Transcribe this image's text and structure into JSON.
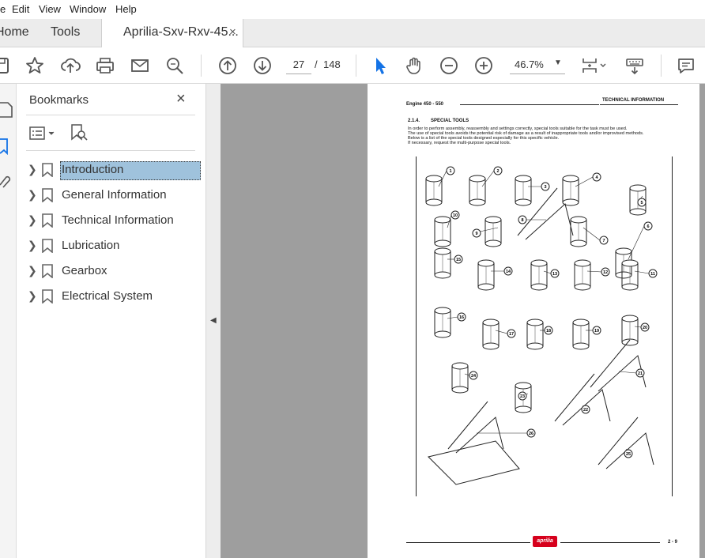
{
  "menu": [
    "e",
    "Edit",
    "View",
    "Window",
    "Help"
  ],
  "tabs": {
    "home": "Home",
    "tools": "Tools",
    "document": "Aprilia-Sxv-Rxv-45...",
    "close": "×"
  },
  "toolbar": {
    "page_current": "27",
    "page_separator": "/",
    "page_total": "148",
    "zoom": "46.7%"
  },
  "bookmarks": {
    "title": "Bookmarks",
    "close": "×",
    "items": [
      {
        "label": "Introduction",
        "selected": true
      },
      {
        "label": "General Information",
        "selected": false
      },
      {
        "label": "Technical Information",
        "selected": false
      },
      {
        "label": "Lubrication",
        "selected": false
      },
      {
        "label": "Gearbox",
        "selected": false
      },
      {
        "label": "Electrical System",
        "selected": false
      }
    ]
  },
  "page": {
    "header_left": "Engine 450 - 550",
    "header_right": "TECHNICAL INFORMATION",
    "section_number": "2.1.4.",
    "section_title": "SPECIAL TOOLS",
    "body": [
      "In order to perform assembly, reassembly and settings correctly, special tools suitable for the task must be used.",
      "The use of special tools avoids the potential risk of damage as a result of inappropriate tools and/or improvised methods.",
      "Below is a list of the special tools designed especially for this specific vehicle.",
      "If necessary, request the multi-purpose special tools."
    ],
    "tool_numbers": [
      "1",
      "2",
      "3",
      "4",
      "5",
      "6",
      "7",
      "8",
      "9",
      "10",
      "11",
      "12",
      "13",
      "14",
      "15",
      "16",
      "17",
      "18",
      "19",
      "20",
      "21",
      "22",
      "23",
      "24",
      "25",
      "26"
    ],
    "logo": "aprilia",
    "page_number": "2 - 9"
  },
  "colors": {
    "selection": "#9fc2dc",
    "accent_blue": "#1473e6",
    "doc_gray": "#9e9e9e",
    "logo_red": "#d6001c"
  }
}
